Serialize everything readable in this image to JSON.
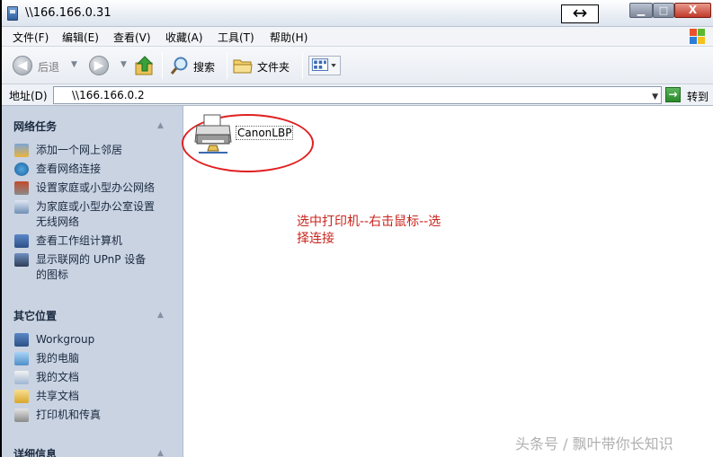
{
  "window": {
    "title": "\\\\166.166.0.31",
    "resize_cursor_glyph": "↔",
    "min_glyph": "▁",
    "max_glyph": "□",
    "close_glyph": "X"
  },
  "menu": [
    "文件(F)",
    "编辑(E)",
    "查看(V)",
    "收藏(A)",
    "工具(T)",
    "帮助(H)"
  ],
  "toolbar": {
    "back_label": "后退",
    "search_label": "搜索",
    "folders_label": "文件夹",
    "back_glyph": "◀",
    "forward_glyph": "▶",
    "dd_glyph": "▼"
  },
  "address": {
    "label": "地址(D)",
    "value": "\\\\166.166.0.2",
    "dd_glyph": "▼",
    "go_label": "转到",
    "go_glyph": "→"
  },
  "taskpane": {
    "network_tasks": {
      "title": "网络任务",
      "items": [
        {
          "label": "添加一个网上邻居",
          "icon": "add-network-place-icon"
        },
        {
          "label": "查看网络连接",
          "icon": "network-connections-icon"
        },
        {
          "label": "设置家庭或小型办公网络",
          "icon": "home-network-icon"
        },
        {
          "label": "为家庭或小型办公室设置",
          "label2": "无线网络",
          "icon": "wireless-setup-icon"
        },
        {
          "label": "查看工作组计算机",
          "icon": "workgroup-computers-icon"
        },
        {
          "label": "显示联网的 UPnP 设备",
          "label2": "的图标",
          "icon": "upnp-icon"
        }
      ]
    },
    "other_places": {
      "title": "其它位置",
      "items": [
        {
          "label": "Workgroup",
          "icon": "workgroup-icon"
        },
        {
          "label": "我的电脑",
          "icon": "my-computer-icon"
        },
        {
          "label": "我的文档",
          "icon": "my-documents-icon"
        },
        {
          "label": "共享文档",
          "icon": "shared-documents-icon"
        },
        {
          "label": "打印机和传真",
          "icon": "printers-faxes-icon"
        }
      ]
    },
    "details": {
      "title": "详细信息"
    },
    "chevron_glyph": "▲"
  },
  "content": {
    "printer_name": "CanonLBP",
    "annotation_line1": "选中打印机--右击鼠标--选",
    "annotation_line2": "择连接",
    "watermark": "头条号 / 飘叶带你长知识"
  },
  "colors": {
    "annotation": "#c8241c",
    "ellipse": "#e02020",
    "taskpane_bg": "#c9d3e2"
  }
}
